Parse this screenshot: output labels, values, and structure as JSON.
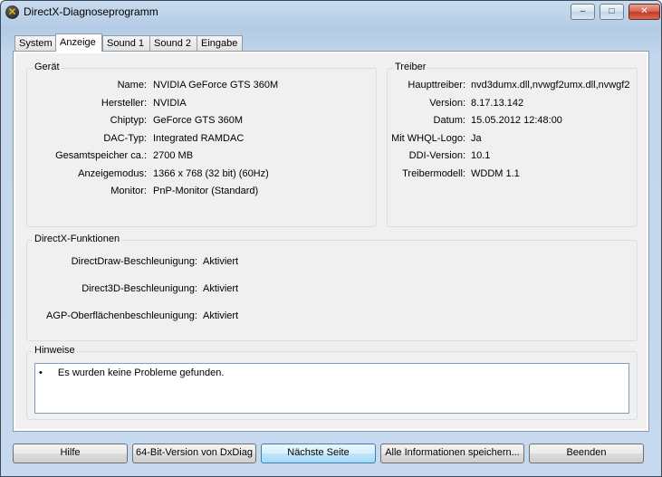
{
  "window": {
    "title": "DirectX-Diagnoseprogramm",
    "icon_symbol": "✕",
    "controls": {
      "min": "–",
      "max": "□",
      "close": "✕"
    }
  },
  "tabs": [
    "System",
    "Anzeige",
    "Sound 1",
    "Sound 2",
    "Eingabe"
  ],
  "active_tab": "Anzeige",
  "device": {
    "title": "Gerät",
    "rows": [
      {
        "label": "Name:",
        "value": "NVIDIA GeForce GTS 360M"
      },
      {
        "label": "Hersteller:",
        "value": "NVIDIA"
      },
      {
        "label": "Chiptyp:",
        "value": "GeForce GTS 360M"
      },
      {
        "label": "DAC-Typ:",
        "value": "Integrated RAMDAC"
      },
      {
        "label": "Gesamtspeicher ca.:",
        "value": "2700 MB"
      },
      {
        "label": "Anzeigemodus:",
        "value": "1366 x 768 (32 bit) (60Hz)"
      },
      {
        "label": "Monitor:",
        "value": "PnP-Monitor (Standard)"
      }
    ]
  },
  "driver": {
    "title": "Treiber",
    "rows": [
      {
        "label": "Haupttreiber:",
        "value": "nvd3dumx.dll,nvwgf2umx.dll,nvwgf2"
      },
      {
        "label": "Version:",
        "value": "8.17.13.142"
      },
      {
        "label": "Datum:",
        "value": "15.05.2012 12:48:00"
      },
      {
        "label": "Mit WHQL-Logo:",
        "value": "Ja"
      },
      {
        "label": "DDI-Version:",
        "value": "10.1"
      },
      {
        "label": "Treibermodell:",
        "value": "WDDM 1.1"
      }
    ]
  },
  "directx": {
    "title": "DirectX-Funktionen",
    "rows": [
      {
        "label": "DirectDraw-Beschleunigung:",
        "value": "Aktiviert"
      },
      {
        "label": "Direct3D-Beschleunigung:",
        "value": "Aktiviert"
      },
      {
        "label": "AGP-Oberflächenbeschleunigung:",
        "value": "Aktiviert"
      }
    ]
  },
  "notes": {
    "title": "Hinweise",
    "bullet": "•",
    "items": [
      "Es wurden keine Probleme gefunden."
    ]
  },
  "buttons": {
    "help": "Hilfe",
    "bit64": "64-Bit-Version von DxDiag",
    "next": "Nächste Seite",
    "save_all": "Alle Informationen speichern...",
    "exit": "Beenden"
  }
}
